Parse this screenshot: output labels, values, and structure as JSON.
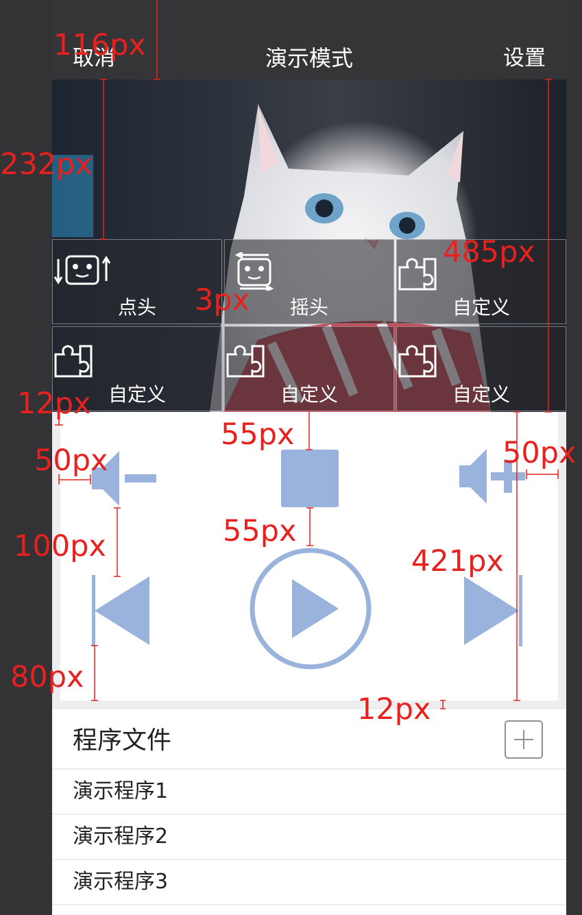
{
  "header": {
    "cancel": "取消",
    "title": "演示模式",
    "settings": "设置"
  },
  "actions": [
    {
      "label": "点头",
      "icon": "nod-head-icon"
    },
    {
      "label": "摇头",
      "icon": "shake-head-icon"
    },
    {
      "label": "自定义",
      "icon": "puzzle-icon"
    },
    {
      "label": "自定义",
      "icon": "puzzle-icon"
    },
    {
      "label": "自定义",
      "icon": "puzzle-icon"
    },
    {
      "label": "自定义",
      "icon": "puzzle-icon"
    }
  ],
  "controls": {
    "accent": "#9ab3dc",
    "items": [
      "volume-down-icon",
      "stop-icon",
      "volume-up-icon",
      "previous-icon",
      "play-icon",
      "next-icon"
    ]
  },
  "files": {
    "title": "程序文件",
    "items": [
      "演示程序1",
      "演示程序2",
      "演示程序3"
    ]
  },
  "annotations": {
    "a1": "116px",
    "a2": "232px",
    "a3": "485px",
    "a4": "3px",
    "a5": "12px",
    "a6": "55px",
    "a7": "50px",
    "a8": "50px",
    "a9": "100px",
    "a10": "55px",
    "a11": "421px",
    "a12": "80px",
    "a13": "12px"
  }
}
